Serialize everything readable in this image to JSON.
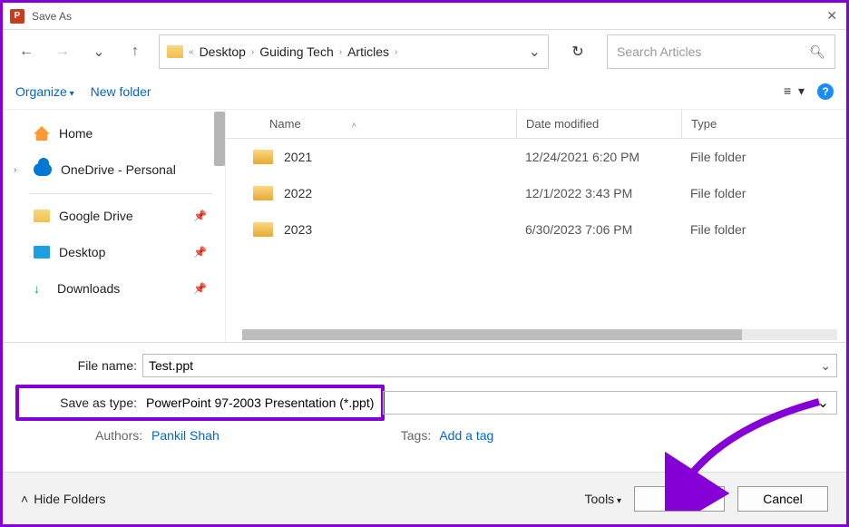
{
  "window": {
    "title": "Save As"
  },
  "breadcrumb": {
    "prefix": "«",
    "items": [
      "Desktop",
      "Guiding Tech",
      "Articles"
    ]
  },
  "search": {
    "placeholder": "Search Articles"
  },
  "toolbar": {
    "organize": "Organize",
    "new_folder": "New folder"
  },
  "sidebar": {
    "items": [
      {
        "label": "Home"
      },
      {
        "label": "OneDrive - Personal"
      },
      {
        "label": "Google Drive"
      },
      {
        "label": "Desktop"
      },
      {
        "label": "Downloads"
      }
    ]
  },
  "columns": {
    "name": "Name",
    "date": "Date modified",
    "type": "Type"
  },
  "rows": [
    {
      "name": "2021",
      "date": "12/24/2021 6:20 PM",
      "type": "File folder"
    },
    {
      "name": "2022",
      "date": "12/1/2022 3:43 PM",
      "type": "File folder"
    },
    {
      "name": "2023",
      "date": "6/30/2023 7:06 PM",
      "type": "File folder"
    }
  ],
  "form": {
    "file_name_label": "File name:",
    "file_name_value": "Test.ppt",
    "save_as_type_label": "Save as type:",
    "save_as_type_value": "PowerPoint 97-2003 Presentation (*.ppt)",
    "authors_label": "Authors:",
    "authors_value": "Pankil Shah",
    "tags_label": "Tags:",
    "tags_value": "Add a tag"
  },
  "footer": {
    "hide_folders": "Hide Folders",
    "tools": "Tools",
    "save": "Save",
    "cancel": "Cancel"
  },
  "colors": {
    "highlight": "#8400d6",
    "link": "#0066cc"
  }
}
